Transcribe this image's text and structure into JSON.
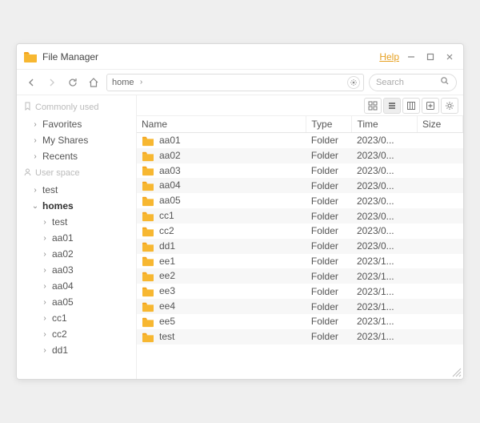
{
  "titlebar": {
    "app_name": "File Manager",
    "help_label": "Help"
  },
  "toolbar": {
    "breadcrumb": "home",
    "search_placeholder": "Search"
  },
  "sidebar": {
    "section1_label": "Commonly used",
    "section1_items": [
      {
        "label": "Favorites"
      },
      {
        "label": "My Shares"
      },
      {
        "label": "Recents"
      }
    ],
    "section2_label": "User space",
    "section2_items": [
      {
        "label": "test",
        "children": []
      },
      {
        "label": "homes",
        "expanded": true,
        "children": [
          {
            "label": "test"
          },
          {
            "label": "aa01"
          },
          {
            "label": "aa02"
          },
          {
            "label": "aa03"
          },
          {
            "label": "aa04"
          },
          {
            "label": "aa05"
          },
          {
            "label": "cc1"
          },
          {
            "label": "cc2"
          },
          {
            "label": "dd1"
          }
        ]
      }
    ]
  },
  "table": {
    "columns": {
      "name": "Name",
      "type": "Type",
      "time": "Time",
      "size": "Size"
    },
    "type_folder": "Folder",
    "rows": [
      {
        "name": "aa01",
        "time": "2023/0..."
      },
      {
        "name": "aa02",
        "time": "2023/0..."
      },
      {
        "name": "aa03",
        "time": "2023/0..."
      },
      {
        "name": "aa04",
        "time": "2023/0..."
      },
      {
        "name": "aa05",
        "time": "2023/0..."
      },
      {
        "name": "cc1",
        "time": "2023/0..."
      },
      {
        "name": "cc2",
        "time": "2023/0..."
      },
      {
        "name": "dd1",
        "time": "2023/0..."
      },
      {
        "name": "ee1",
        "time": "2023/1..."
      },
      {
        "name": "ee2",
        "time": "2023/1..."
      },
      {
        "name": "ee3",
        "time": "2023/1..."
      },
      {
        "name": "ee4",
        "time": "2023/1..."
      },
      {
        "name": "ee5",
        "time": "2023/1..."
      },
      {
        "name": "test",
        "time": "2023/1..."
      }
    ]
  },
  "view": {
    "active": "list"
  }
}
